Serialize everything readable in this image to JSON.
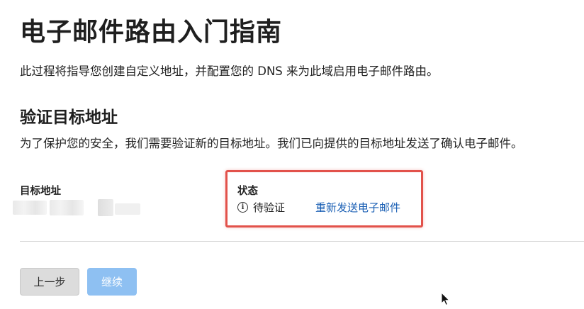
{
  "page": {
    "title": "电子邮件路由入门指南",
    "intro": "此过程将指导您创建自定义地址，并配置您的 DNS 来为此域启用电子邮件路由。"
  },
  "verify": {
    "title": "验证目标地址",
    "description": "为了保护您的安全，我们需要验证新的目标地址。我们已向提供的目标地址发送了确认电子邮件。"
  },
  "table": {
    "dest_header": "目标地址",
    "status_header": "状态",
    "status_value": "待验证",
    "resend_link": "重新发送电子邮件"
  },
  "actions": {
    "back_label": "上一步",
    "continue_label": "继续"
  },
  "icons": {
    "status_icon": "info-circle-icon",
    "cursor": "mouse-pointer-icon"
  },
  "colors": {
    "link": "#1a5fb4",
    "highlight_border": "#e2524b",
    "continue_disabled": "#8ec0f2"
  }
}
